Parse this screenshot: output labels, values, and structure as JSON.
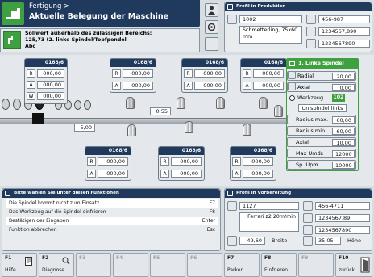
{
  "header": {
    "breadcrumb": "Fertigung >",
    "title": "Aktuelle Belegung der Maschine"
  },
  "message": {
    "line1": "Sollwert außerhalb des zulässigen Bereichs:",
    "line2": "125,73 (2. linke Spindel/Topfpendel",
    "line3": "Abc"
  },
  "profile_production": {
    "title": "Profil in Produktion",
    "number": "1002",
    "name": "Schmetterling, 75x60 mm",
    "code1": "456-987",
    "code2": "1234567,890",
    "code3": "1234567890"
  },
  "profile_preparation": {
    "title": "Profil in Vorbereitung",
    "number": "1127",
    "name": "Ferrari z2 20m/min",
    "width_value": "49,60",
    "width_label": "Breite",
    "height_value": "35,05",
    "height_label": "Höhe",
    "code1": "456-4711",
    "code2": "1234567,89",
    "code3": "1234567890"
  },
  "spindles_top": [
    {
      "id": "0168/6",
      "rows": [
        {
          "k": "R",
          "v": "000,00"
        },
        {
          "k": "A",
          "v": "000,00"
        },
        {
          "k": "W",
          "v": "000,00"
        }
      ]
    },
    {
      "id": "0168/6",
      "rows": [
        {
          "k": "R",
          "v": "000,00"
        },
        {
          "k": "A",
          "v": "000,00"
        }
      ]
    },
    {
      "id": "0168/6",
      "rows": [
        {
          "k": "R",
          "v": "000,00"
        },
        {
          "k": "A",
          "v": "000,00"
        }
      ]
    },
    {
      "id": "0168/6",
      "rows": [
        {
          "k": "R",
          "v": "000,00"
        },
        {
          "k": "A",
          "v": "000,00"
        }
      ]
    }
  ],
  "spindles_bottom": [
    {
      "id": "0168/6",
      "rows": [
        {
          "k": "R",
          "v": "000,00"
        },
        {
          "k": "A",
          "v": "000,00"
        }
      ]
    },
    {
      "id": "0168/6",
      "rows": [
        {
          "k": "R",
          "v": "000,00"
        },
        {
          "k": "A",
          "v": "000,00"
        }
      ]
    },
    {
      "id": "0168/6",
      "rows": [
        {
          "k": "R",
          "v": "000,00"
        },
        {
          "k": "A",
          "v": "000,00"
        }
      ]
    }
  ],
  "machine": {
    "dim_left": "5,00",
    "dim_mid": "0,55"
  },
  "spindle_panel": {
    "title": "1. Linke Spindel",
    "radial_label": "Radial",
    "radial": "20,00",
    "axial_label": "Axial",
    "axial": "0,00",
    "tool_label": "Werkzeug",
    "tool_no": "102",
    "tool_name": "Unispindel links",
    "rows": [
      {
        "k": "Radius max.",
        "v": "60,00"
      },
      {
        "k": "Radius min.",
        "v": "60,00"
      },
      {
        "k": "Axial",
        "v": "10,00"
      },
      {
        "k": "Max Umdr.",
        "v": "12000"
      },
      {
        "k": "Sp. Upm",
        "v": "10000"
      }
    ]
  },
  "functions": {
    "title": "Bitte wählen Sie unter diesen Funktionen",
    "rows": [
      {
        "d": "Die Spindel kommt nicht zum Einsatz",
        "k": "F7"
      },
      {
        "d": "Das Werkzeug auf die Spindel einfrieren",
        "k": "F8"
      },
      {
        "d": "Bestätigen der Eingaben",
        "k": "Enter"
      },
      {
        "d": "Funktion abbrechen",
        "k": "Esc"
      }
    ]
  },
  "fkeys": [
    {
      "n": "F1",
      "s": "Hilfe",
      "on": true
    },
    {
      "n": "F2",
      "s": "Diagnose",
      "on": true
    },
    {
      "n": "F3",
      "s": "",
      "on": false
    },
    {
      "n": "F4",
      "s": "",
      "on": false
    },
    {
      "n": "F5",
      "s": "",
      "on": false
    },
    {
      "n": "F6",
      "s": "",
      "on": false
    },
    {
      "n": "F7",
      "s": "Parken",
      "on": true
    },
    {
      "n": "F8",
      "s": "Einfrieren",
      "on": true
    },
    {
      "n": "F9",
      "s": "",
      "on": false
    },
    {
      "n": "F10",
      "s": "zurück",
      "on": true
    }
  ]
}
